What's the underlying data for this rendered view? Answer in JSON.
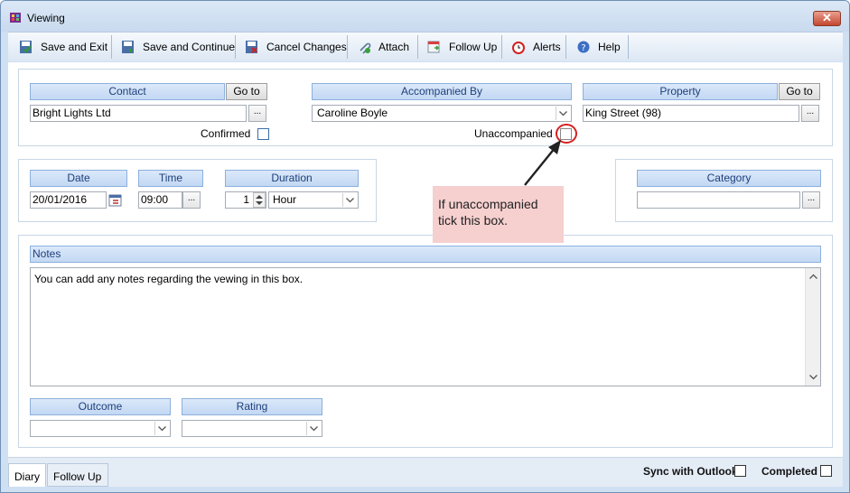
{
  "window": {
    "title": "Viewing",
    "close_label": "✕"
  },
  "toolbar": {
    "save_exit": "Save and Exit",
    "save_continue": "Save and Continue",
    "cancel_changes": "Cancel Changes",
    "attach": "Attach",
    "follow_up": "Follow Up",
    "alerts": "Alerts",
    "help": "Help"
  },
  "contact": {
    "label": "Contact",
    "goto": "Go to",
    "value": "Bright Lights Ltd",
    "dots": "..."
  },
  "accompanied": {
    "label": "Accompanied By",
    "value": "Caroline Boyle"
  },
  "property": {
    "label": "Property",
    "goto": "Go to",
    "value": "King Street (98)",
    "dots": "..."
  },
  "confirmed": {
    "label": "Confirmed",
    "checked": false
  },
  "unaccompanied": {
    "label": "Unaccompanied",
    "checked": false
  },
  "date": {
    "label": "Date",
    "value": "20/01/2016"
  },
  "time": {
    "label": "Time",
    "value": "09:00",
    "dots": "..."
  },
  "duration": {
    "label": "Duration",
    "amount": "1",
    "unit": "Hour"
  },
  "category": {
    "label": "Category",
    "value": "",
    "dots": "..."
  },
  "callout": {
    "line1": "If unaccompanied",
    "line2": "tick this box."
  },
  "notes": {
    "label": "Notes",
    "text": "You can add any notes regarding the vewing in this box."
  },
  "outcome": {
    "label": "Outcome",
    "value": ""
  },
  "rating": {
    "label": "Rating",
    "value": ""
  },
  "tabs": [
    "Diary",
    "Follow Up"
  ],
  "footer": {
    "sync_outlook": "Sync with Outlook",
    "completed": "Completed"
  },
  "colors": {
    "accent": "#1e3f7a",
    "label_bg": "#c2d8f3",
    "callout_bg": "#f6cfcf",
    "highlight_ring": "#d42020"
  }
}
